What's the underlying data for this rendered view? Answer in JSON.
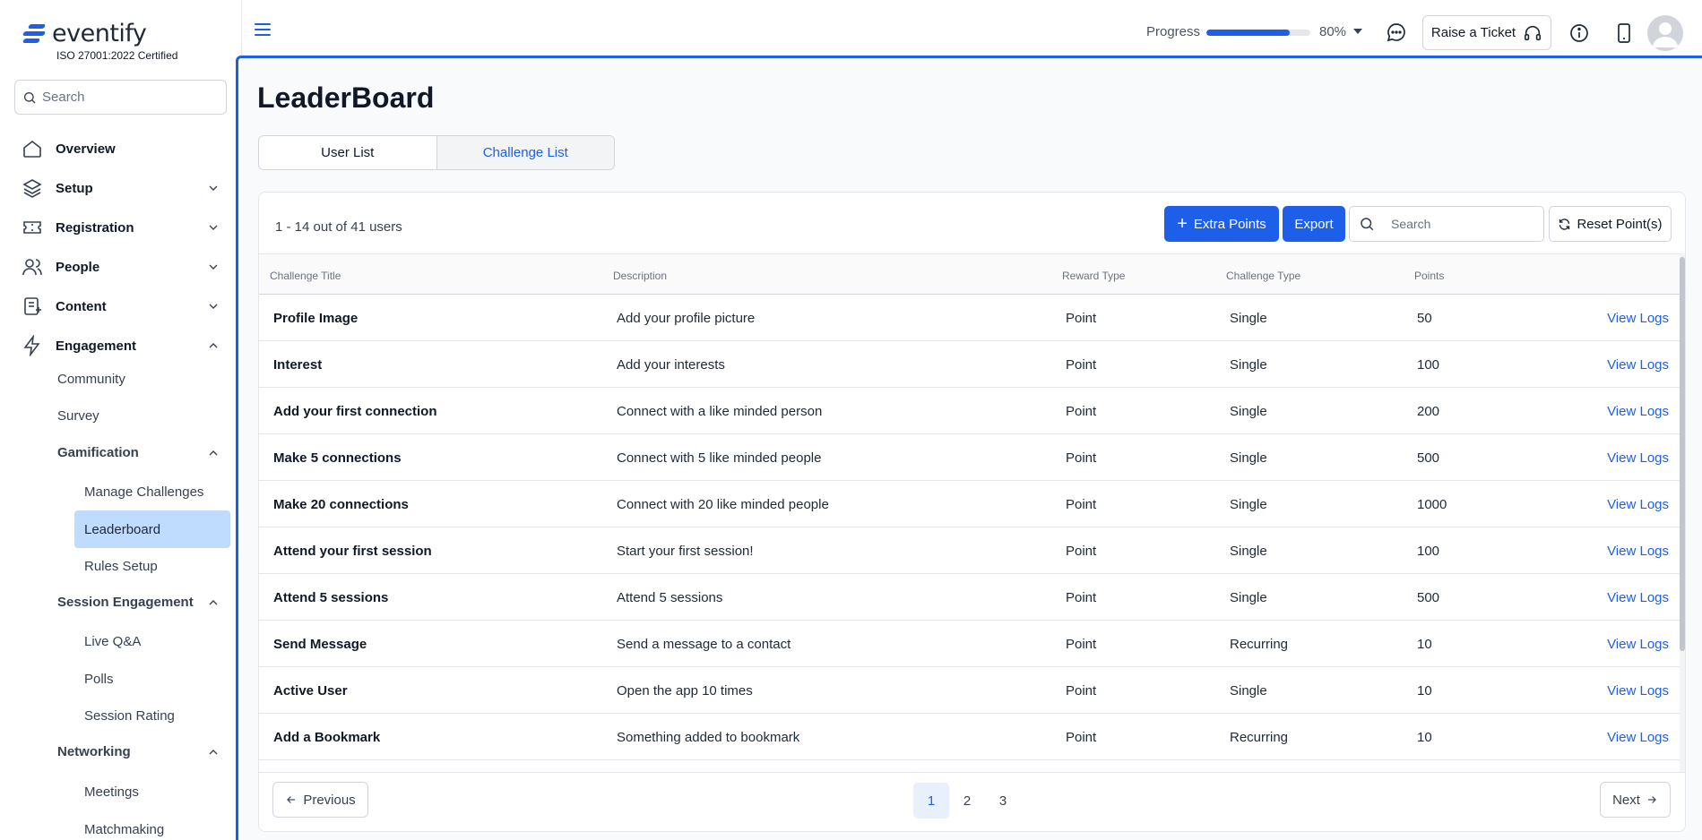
{
  "brand": {
    "name": "eventify",
    "certification": "ISO 27001:2022 Certified",
    "accent": "#1d5fe8"
  },
  "sidebar": {
    "search_placeholder": "Search",
    "items": [
      {
        "label": "Overview",
        "icon": "home-icon"
      },
      {
        "label": "Setup",
        "icon": "layers-icon"
      },
      {
        "label": "Registration",
        "icon": "ticket-icon"
      },
      {
        "label": "People",
        "icon": "users-icon"
      },
      {
        "label": "Content",
        "icon": "document-icon"
      },
      {
        "label": "Engagement",
        "icon": "lightning-icon"
      }
    ],
    "engagement": {
      "community": "Community",
      "survey": "Survey",
      "gamification": {
        "label": "Gamification",
        "items": [
          "Manage Challenges",
          "Leaderboard",
          "Rules Setup"
        ]
      },
      "session_engagement": {
        "label": "Session Engagement",
        "items": [
          "Live Q&A",
          "Polls",
          "Session Rating"
        ]
      },
      "networking": {
        "label": "Networking",
        "items": [
          "Meetings",
          "Matchmaking"
        ]
      }
    }
  },
  "topbar": {
    "progress_label": "Progress",
    "progress_value": "80%",
    "progress_fraction": 0.8,
    "ticket_label": "Raise a Ticket"
  },
  "page": {
    "title": "LeaderBoard",
    "tabs": [
      "User List",
      "Challenge List"
    ],
    "active_tab": "Challenge List"
  },
  "table": {
    "count_text": "1 - 14 out of 41 users",
    "extra_points_label": "Extra Points",
    "export_label": "Export",
    "search_placeholder": "Search",
    "reset_label": "Reset Point(s)",
    "columns": [
      "Challenge Title",
      "Description",
      "Reward Type",
      "Challenge Type",
      "Points"
    ],
    "action_label": "View Logs",
    "rows": [
      [
        "Profile Image",
        "Add your profile picture",
        "Point",
        "Single",
        "50"
      ],
      [
        "Interest",
        "Add your interests",
        "Point",
        "Single",
        "100"
      ],
      [
        "Add your first connection",
        "Connect with a like minded person",
        "Point",
        "Single",
        "200"
      ],
      [
        "Make 5 connections",
        "Connect with 5 like minded people",
        "Point",
        "Single",
        "500"
      ],
      [
        "Make 20 connections",
        "Connect with 20 like minded people",
        "Point",
        "Single",
        "1000"
      ],
      [
        "Attend your first session",
        "Start your first session!",
        "Point",
        "Single",
        "100"
      ],
      [
        "Attend 5 sessions",
        "Attend 5 sessions",
        "Point",
        "Single",
        "500"
      ],
      [
        "Send Message",
        "Send a message to a contact",
        "Point",
        "Recurring",
        "10"
      ],
      [
        "Active User",
        "Open the app 10 times",
        "Point",
        "Single",
        "10"
      ],
      [
        "Add a Bookmark",
        "Something added to bookmark",
        "Point",
        "Recurring",
        "10"
      ]
    ]
  },
  "pagination": {
    "previous_label": "Previous",
    "next_label": "Next",
    "pages": [
      "1",
      "2",
      "3"
    ],
    "current_page": "1"
  }
}
